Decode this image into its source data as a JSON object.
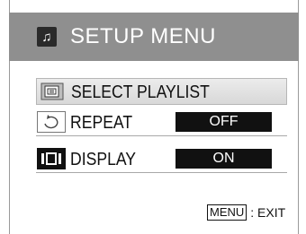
{
  "header": {
    "title": "SETUP MENU",
    "icon": "music-note-icon"
  },
  "menu": {
    "items": [
      {
        "label": "SELECT PLAYLIST",
        "icon": "playlist-icon",
        "selected": true
      },
      {
        "label": "REPEAT",
        "icon": "repeat-icon",
        "value": "OFF"
      },
      {
        "label": "DISPLAY",
        "icon": "display-icon",
        "value": "ON"
      }
    ]
  },
  "footer": {
    "key_label": "MENU",
    "action_label": ": EXIT"
  },
  "colors": {
    "header_bg": "#8f8f8f",
    "value_bg": "#111111",
    "selected_bg": "#e0e0e0"
  }
}
